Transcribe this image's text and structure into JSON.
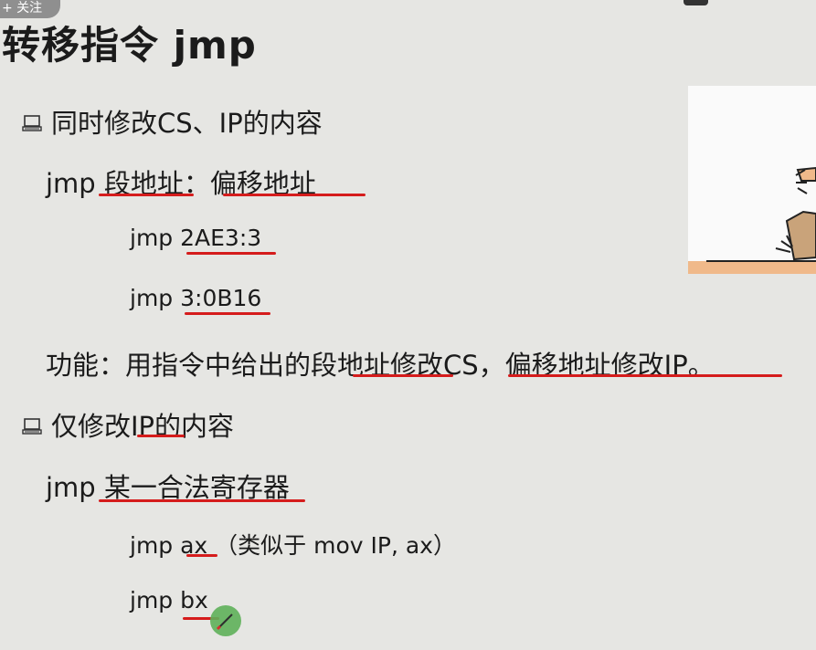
{
  "badge": {
    "text": "+ 关注"
  },
  "slide": {
    "title": "转移指令 jmp",
    "section1": "同时修改CS、IP的内容",
    "line_seg_off": "jmp 段地址：偏移地址",
    "ex1": "jmp 2AE3:3",
    "ex2": "jmp 3:0B16",
    "function": "功能：用指令中给出的段地址修改CS，偏移地址修改IP。",
    "section2": "仅修改IP的内容",
    "line_reg": "jmp 某一合法寄存器",
    "ex3": "jmp ax （类似于 mov IP, ax）",
    "ex4": "jmp bx"
  },
  "colors": {
    "background": "#e6e6e3",
    "underline": "#d51c1c",
    "text": "#1b1b1b"
  },
  "icons": {
    "bullet": "laptop-icon",
    "cursor": "pen-cursor-icon"
  }
}
